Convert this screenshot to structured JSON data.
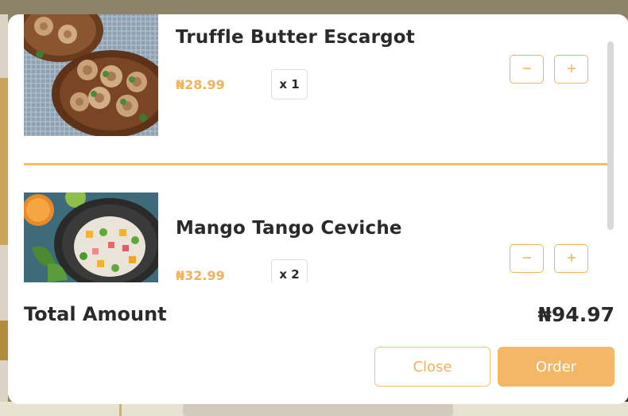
{
  "cart": {
    "items": [
      {
        "name": "Truffle Butter Escargot",
        "price": "₦28.99",
        "quantity": "x 1",
        "image_alt": "Escargot dish"
      },
      {
        "name": "Mango Tango Ceviche",
        "price": "₦32.99",
        "quantity": "x 2",
        "image_alt": "Ceviche bowl"
      }
    ],
    "total_label": "Total Amount",
    "total_value": "₦94.97"
  },
  "actions": {
    "close_label": "Close",
    "order_label": "Order"
  },
  "icons": {
    "decrement": "minus-icon",
    "increment": "plus-icon"
  },
  "colors": {
    "accent": "#f2b25c",
    "order_button": "#f3b766",
    "text": "#2a2a2a"
  }
}
